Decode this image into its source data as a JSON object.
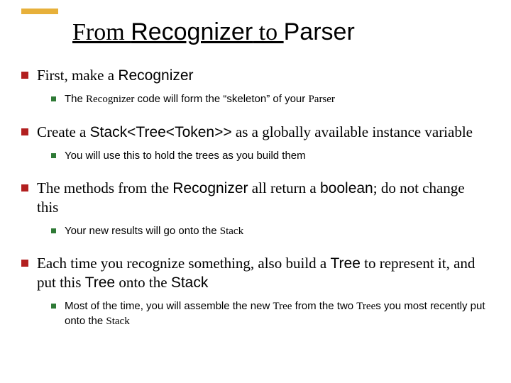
{
  "title": {
    "pre": "From ",
    "code1": "Recognizer",
    "mid": " to ",
    "code2": "Parser"
  },
  "items": [
    {
      "line": [
        {
          "t": "First, make a "
        },
        {
          "t": "Recognizer",
          "code": true
        }
      ],
      "sub": [
        [
          {
            "t": "The "
          },
          {
            "t": "Recognizer",
            "code": true
          },
          {
            "t": " code will form the “skeleton” of your "
          },
          {
            "t": "Parser",
            "code": true
          }
        ]
      ]
    },
    {
      "line": [
        {
          "t": "Create a "
        },
        {
          "t": "Stack<Tree<Token>>",
          "code": true
        },
        {
          "t": " as a globally available instance variable"
        }
      ],
      "sub": [
        [
          {
            "t": "You will use this to hold the trees as you build them"
          }
        ]
      ]
    },
    {
      "line": [
        {
          "t": "The methods from the "
        },
        {
          "t": "Recognizer",
          "code": true
        },
        {
          "t": " all return a "
        },
        {
          "t": "boolean",
          "code": true
        },
        {
          "t": "; do not change this"
        }
      ],
      "sub": [
        [
          {
            "t": "Your new results will go onto the "
          },
          {
            "t": "Stack",
            "code": true
          }
        ]
      ]
    },
    {
      "line": [
        {
          "t": "Each time you recognize something, also build a "
        },
        {
          "t": "Tree",
          "code": true
        },
        {
          "t": " to represent it, and put this "
        },
        {
          "t": "Tree",
          "code": true
        },
        {
          "t": " onto the "
        },
        {
          "t": "Stack",
          "code": true
        }
      ],
      "sub": [
        [
          {
            "t": "Most of the time, you will assemble the new "
          },
          {
            "t": "Tree",
            "code": true
          },
          {
            "t": " from the two "
          },
          {
            "t": "Tree",
            "code": true
          },
          {
            "t": "s you most recently put onto the "
          },
          {
            "t": "Stack",
            "code": true
          }
        ]
      ]
    }
  ]
}
